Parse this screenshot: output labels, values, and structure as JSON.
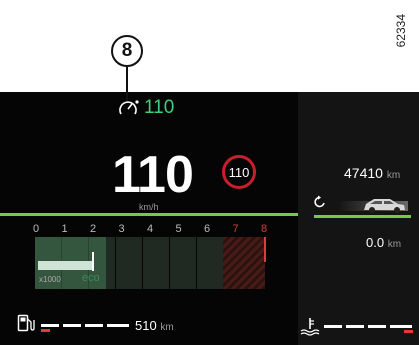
{
  "doc_id": "62334",
  "callout": "8",
  "cruise": {
    "icon": "speed-limiter-icon",
    "value": "110"
  },
  "speed": {
    "value": "110",
    "unit": "km/h"
  },
  "speed_limit": "110",
  "tachometer": {
    "ticks": [
      "0",
      "1",
      "2",
      "3",
      "4",
      "5",
      "6",
      "7",
      "8"
    ],
    "red_ticks": [
      "7",
      "8"
    ],
    "multiplier": "x1000",
    "eco_label": "eco",
    "rpm_fraction": 0.25
  },
  "odometer": {
    "value": "47410",
    "unit": "km"
  },
  "trip": {
    "value": "0.0",
    "unit": "km",
    "icon": "reset-icon"
  },
  "fuel": {
    "icon": "fuel-pump-icon",
    "range": "510",
    "unit": "km"
  },
  "coolant": {
    "icon": "coolant-temperature-icon"
  },
  "colors": {
    "accent_green": "#7ac943",
    "cruise_green": "#3dcf7e",
    "limit_red": "#c8202a"
  }
}
